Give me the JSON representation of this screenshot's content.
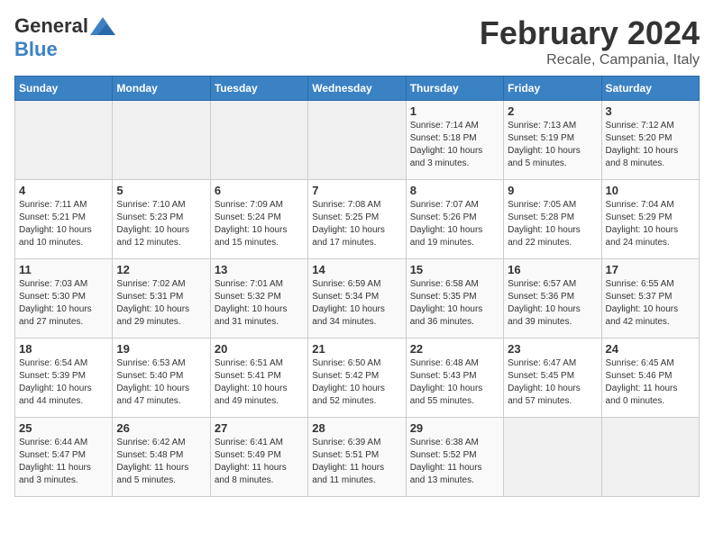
{
  "header": {
    "logo_general": "General",
    "logo_blue": "Blue",
    "month_year": "February 2024",
    "location": "Recale, Campania, Italy"
  },
  "days_of_week": [
    "Sunday",
    "Monday",
    "Tuesday",
    "Wednesday",
    "Thursday",
    "Friday",
    "Saturday"
  ],
  "weeks": [
    [
      {
        "day": "",
        "info": ""
      },
      {
        "day": "",
        "info": ""
      },
      {
        "day": "",
        "info": ""
      },
      {
        "day": "",
        "info": ""
      },
      {
        "day": "1",
        "info": "Sunrise: 7:14 AM\nSunset: 5:18 PM\nDaylight: 10 hours\nand 3 minutes."
      },
      {
        "day": "2",
        "info": "Sunrise: 7:13 AM\nSunset: 5:19 PM\nDaylight: 10 hours\nand 5 minutes."
      },
      {
        "day": "3",
        "info": "Sunrise: 7:12 AM\nSunset: 5:20 PM\nDaylight: 10 hours\nand 8 minutes."
      }
    ],
    [
      {
        "day": "4",
        "info": "Sunrise: 7:11 AM\nSunset: 5:21 PM\nDaylight: 10 hours\nand 10 minutes."
      },
      {
        "day": "5",
        "info": "Sunrise: 7:10 AM\nSunset: 5:23 PM\nDaylight: 10 hours\nand 12 minutes."
      },
      {
        "day": "6",
        "info": "Sunrise: 7:09 AM\nSunset: 5:24 PM\nDaylight: 10 hours\nand 15 minutes."
      },
      {
        "day": "7",
        "info": "Sunrise: 7:08 AM\nSunset: 5:25 PM\nDaylight: 10 hours\nand 17 minutes."
      },
      {
        "day": "8",
        "info": "Sunrise: 7:07 AM\nSunset: 5:26 PM\nDaylight: 10 hours\nand 19 minutes."
      },
      {
        "day": "9",
        "info": "Sunrise: 7:05 AM\nSunset: 5:28 PM\nDaylight: 10 hours\nand 22 minutes."
      },
      {
        "day": "10",
        "info": "Sunrise: 7:04 AM\nSunset: 5:29 PM\nDaylight: 10 hours\nand 24 minutes."
      }
    ],
    [
      {
        "day": "11",
        "info": "Sunrise: 7:03 AM\nSunset: 5:30 PM\nDaylight: 10 hours\nand 27 minutes."
      },
      {
        "day": "12",
        "info": "Sunrise: 7:02 AM\nSunset: 5:31 PM\nDaylight: 10 hours\nand 29 minutes."
      },
      {
        "day": "13",
        "info": "Sunrise: 7:01 AM\nSunset: 5:32 PM\nDaylight: 10 hours\nand 31 minutes."
      },
      {
        "day": "14",
        "info": "Sunrise: 6:59 AM\nSunset: 5:34 PM\nDaylight: 10 hours\nand 34 minutes."
      },
      {
        "day": "15",
        "info": "Sunrise: 6:58 AM\nSunset: 5:35 PM\nDaylight: 10 hours\nand 36 minutes."
      },
      {
        "day": "16",
        "info": "Sunrise: 6:57 AM\nSunset: 5:36 PM\nDaylight: 10 hours\nand 39 minutes."
      },
      {
        "day": "17",
        "info": "Sunrise: 6:55 AM\nSunset: 5:37 PM\nDaylight: 10 hours\nand 42 minutes."
      }
    ],
    [
      {
        "day": "18",
        "info": "Sunrise: 6:54 AM\nSunset: 5:39 PM\nDaylight: 10 hours\nand 44 minutes."
      },
      {
        "day": "19",
        "info": "Sunrise: 6:53 AM\nSunset: 5:40 PM\nDaylight: 10 hours\nand 47 minutes."
      },
      {
        "day": "20",
        "info": "Sunrise: 6:51 AM\nSunset: 5:41 PM\nDaylight: 10 hours\nand 49 minutes."
      },
      {
        "day": "21",
        "info": "Sunrise: 6:50 AM\nSunset: 5:42 PM\nDaylight: 10 hours\nand 52 minutes."
      },
      {
        "day": "22",
        "info": "Sunrise: 6:48 AM\nSunset: 5:43 PM\nDaylight: 10 hours\nand 55 minutes."
      },
      {
        "day": "23",
        "info": "Sunrise: 6:47 AM\nSunset: 5:45 PM\nDaylight: 10 hours\nand 57 minutes."
      },
      {
        "day": "24",
        "info": "Sunrise: 6:45 AM\nSunset: 5:46 PM\nDaylight: 11 hours\nand 0 minutes."
      }
    ],
    [
      {
        "day": "25",
        "info": "Sunrise: 6:44 AM\nSunset: 5:47 PM\nDaylight: 11 hours\nand 3 minutes."
      },
      {
        "day": "26",
        "info": "Sunrise: 6:42 AM\nSunset: 5:48 PM\nDaylight: 11 hours\nand 5 minutes."
      },
      {
        "day": "27",
        "info": "Sunrise: 6:41 AM\nSunset: 5:49 PM\nDaylight: 11 hours\nand 8 minutes."
      },
      {
        "day": "28",
        "info": "Sunrise: 6:39 AM\nSunset: 5:51 PM\nDaylight: 11 hours\nand 11 minutes."
      },
      {
        "day": "29",
        "info": "Sunrise: 6:38 AM\nSunset: 5:52 PM\nDaylight: 11 hours\nand 13 minutes."
      },
      {
        "day": "",
        "info": ""
      },
      {
        "day": "",
        "info": ""
      }
    ]
  ]
}
